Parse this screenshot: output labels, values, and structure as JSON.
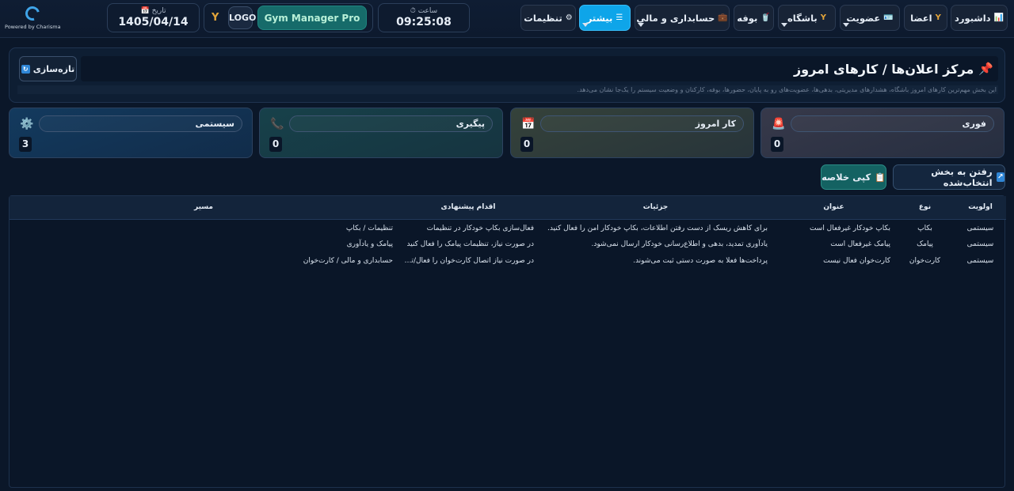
{
  "brand": {
    "powered_by": "Powered by Charisma"
  },
  "topbar": {
    "date_label": "تاریخ",
    "date_value": "1405/04/14",
    "logo_text": "LOGO",
    "app_name": "Gym Manager Pro",
    "clock_label": "ساعت",
    "clock_value": "09:25:08",
    "nav": {
      "dashboard": "داشبورد",
      "members": "اعضا",
      "membership": "عضویت",
      "club": "باشگاه",
      "buffet": "بوفه",
      "accounting": "حسابداری و مالی",
      "more": "بیشتر",
      "settings": "تنظیمات"
    }
  },
  "header": {
    "title": "مرکز اعلان‌ها / کارهای امروز",
    "subtitle": "این بخش مهم‌ترین کارهای امروز باشگاه، هشدارهای مدیریتی، بدهی‌ها، عضویت‌های رو به پایان، حضورها، بوفه، کارکنان و وضعیت سیستم را یک‌جا نشان می‌دهد.",
    "refresh_label": "تازه‌سازی"
  },
  "stats": {
    "urgent": {
      "label": "فوری",
      "value": "0"
    },
    "today": {
      "label": "کار امروز",
      "value": "0"
    },
    "followup": {
      "label": "پیگیری",
      "value": "0"
    },
    "system": {
      "label": "سیستمی",
      "value": "3"
    }
  },
  "actions": {
    "goto_selected": "رفتن به بخش انتخاب‌شده",
    "copy_summary": "کپی خلاصه"
  },
  "table": {
    "headers": {
      "priority": "اولویت",
      "type": "نوع",
      "title": "عنوان",
      "details": "جزئیات",
      "action": "اقدام پیشنهادی",
      "path": "مسیر"
    },
    "rows": [
      {
        "priority": "سیستمی",
        "type": "بکاپ",
        "title": "بکاپ خودکار غیرفعال است",
        "details": "برای کاهش ریسک از دست رفتن اطلاعات، بکاپ خودکار امن را فعال کنید.",
        "action": "فعال‌سازی بکاپ خودکار در تنظیمات",
        "path": "تنظیمات / بکاپ"
      },
      {
        "priority": "سیستمی",
        "type": "پیامک",
        "title": "پیامک غیرفعال است",
        "details": "یادآوری تمدید، بدهی و اطلاع‌رسانی خودکار ارسال نمی‌شود.",
        "action": "در صورت نیاز، تنظیمات پیامک را فعال کنید",
        "path": "پیامک و یادآوری"
      },
      {
        "priority": "سیستمی",
        "type": "کارت‌خوان",
        "title": "کارت‌خوان فعال نیست",
        "details": "پرداخت‌ها فعلا به صورت دستی ثبت می‌شوند.",
        "action": "در صورت نیاز اتصال کارت‌خوان را فعال/تست ...",
        "path": "حسابداری و مالی / کارت‌خوان"
      }
    ]
  }
}
